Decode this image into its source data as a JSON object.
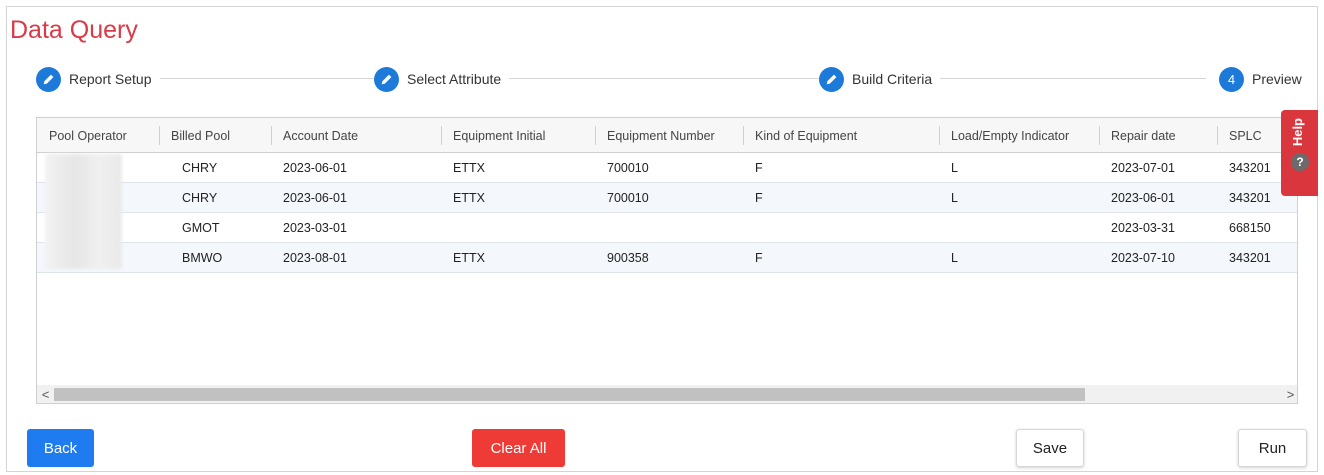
{
  "page": {
    "title": "Data Query"
  },
  "stepper": {
    "steps": [
      {
        "label": "Report Setup",
        "icon": "pencil-icon",
        "state": "completed"
      },
      {
        "label": "Select Attribute",
        "icon": "pencil-icon",
        "state": "completed"
      },
      {
        "label": "Build Criteria",
        "icon": "pencil-icon",
        "state": "completed"
      },
      {
        "label": "Preview",
        "number": "4",
        "state": "active"
      }
    ]
  },
  "table": {
    "columns": [
      "Pool Operator",
      "Billed Pool",
      "Account Date",
      "Equipment Initial",
      "Equipment Number",
      "Kind of Equipment",
      "Load/Empty Indicator",
      "Repair date",
      "SPLC"
    ],
    "rows": [
      [
        "",
        "CHRY",
        "2023-06-01",
        "ETTX",
        "700010",
        "F",
        "L",
        "2023-07-01",
        "343201"
      ],
      [
        "",
        "CHRY",
        "2023-06-01",
        "ETTX",
        "700010",
        "F",
        "L",
        "2023-06-01",
        "343201"
      ],
      [
        "",
        "GMOT",
        "2023-03-01",
        "",
        "",
        "",
        "",
        "2023-03-31",
        "668150"
      ],
      [
        "",
        "BMWO",
        "2023-08-01",
        "ETTX",
        "900358",
        "F",
        "L",
        "2023-07-10",
        "343201"
      ]
    ],
    "scroll_left_glyph": "<",
    "scroll_right_glyph": ">"
  },
  "help": {
    "label": "Help",
    "icon_glyph": "?"
  },
  "buttons": {
    "back": "Back",
    "clear_all": "Clear All",
    "save": "Save",
    "run": "Run"
  },
  "colors": {
    "accent_blue": "#1e7ad8",
    "title_red": "#d93a47",
    "clear_red": "#ef3b36",
    "help_red": "#d9363e"
  }
}
